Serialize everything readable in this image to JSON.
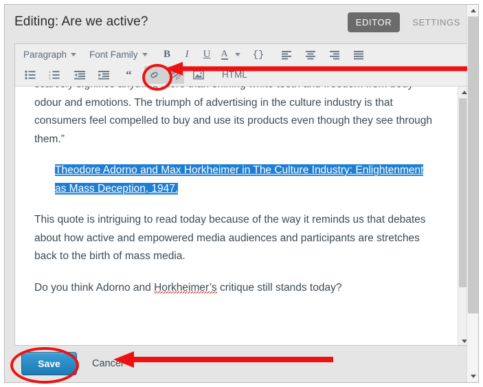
{
  "header": {
    "title": "Editing: Are we active?",
    "tabs": [
      {
        "label": "EDITOR",
        "active": true
      },
      {
        "label": "SETTINGS",
        "active": false
      }
    ]
  },
  "toolbar": {
    "row1": {
      "paragraph_select": "Paragraph",
      "font_family_select": "Font Family",
      "bold": "B",
      "italic": "I",
      "underline": "U",
      "text_color": "A",
      "code": "{}",
      "align_left": "align-left-icon",
      "align_center": "align-center-icon",
      "align_right": "align-right-icon",
      "align_justify": "align-justify-icon"
    },
    "row2": {
      "bullet_list": "bullet-list-icon",
      "numbered_list": "numbered-list-icon",
      "outdent": "outdent-icon",
      "indent": "indent-icon",
      "blockquote": "“",
      "link": "link-icon",
      "unlink": "unlink-icon",
      "image": "image-icon",
      "html": "HTML"
    }
  },
  "content": {
    "paragraphs": [
      {
        "id": "para-quote-continued",
        "text": "scarcely signifies anything more than shining white teeth and freedom from body odour and emotions. The triumph of advertising in the culture industry is that consumers feel compelled to buy and use its products even though they see through them.”"
      },
      {
        "id": "para-attribution",
        "selected": true,
        "text": "Theodore Adorno and Max Horkheimer in The Culture Industry: Enlightenment as Mass Deception, 1947."
      },
      {
        "id": "para-commentary",
        "text": "This quote is intriguing to read today because of the way it reminds us that debates about how active and empowered media audiences and participants are stretches back to the birth of mass media."
      }
    ],
    "question": {
      "before": "Do you think Adorno and ",
      "misspelled": "Horkheimer’s",
      "after": " critique still stands today?"
    }
  },
  "footer": {
    "save_label": "Save",
    "cancel_label": "Cancel"
  },
  "colors": {
    "selection_blue": "#1d7fd4",
    "annotation_red": "#ee1111",
    "save_button_blue": "#2b8bc4",
    "active_tab_gray": "#6b6b6b",
    "spellcheck_red": "#d93025"
  }
}
